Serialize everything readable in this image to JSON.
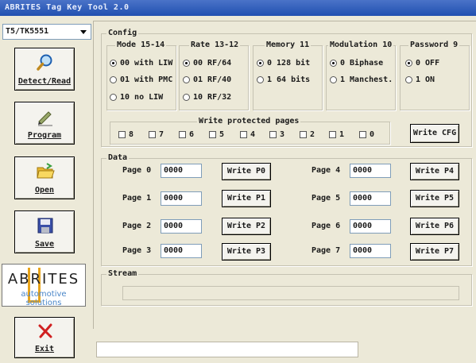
{
  "window": {
    "title": "ABRITES Tag Key Tool 2.0"
  },
  "device_select": {
    "value": "T5/TK5551"
  },
  "sidebar": {
    "detect_label": "Detect/Read",
    "program_label": "Program",
    "open_label": "Open",
    "save_label": "Save",
    "exit_label": "Exit",
    "logo": {
      "brand": "ABRITES",
      "tagline": "automotive solutions"
    }
  },
  "config": {
    "title": "Config",
    "mode": {
      "title": "Mode 15-14",
      "options": [
        "00 with LIW",
        "01 with PMC",
        "10 no LIW"
      ],
      "selected": 0
    },
    "rate": {
      "title": "Rate 13-12",
      "options": [
        "00 RF/64",
        "01 RF/40",
        "10 RF/32"
      ],
      "selected": 0
    },
    "memory": {
      "title": "Memory 11",
      "options": [
        "0 128 bit",
        "1 64 bits"
      ],
      "selected": 0
    },
    "modulation": {
      "title": "Modulation 10",
      "options": [
        "0 Biphase",
        "1 Manchest."
      ],
      "selected": 0
    },
    "password": {
      "title": "Password 9",
      "options": [
        "0 OFF",
        "1 ON"
      ],
      "selected": 0
    },
    "write_protected": {
      "title": "Write protected pages",
      "pages": [
        "8",
        "7",
        "6",
        "5",
        "4",
        "3",
        "2",
        "1",
        "0"
      ]
    },
    "write_cfg_label": "Write CFG"
  },
  "data": {
    "title": "Data",
    "pages": [
      {
        "label": "Page 0",
        "value": "0000",
        "button": "Write P0"
      },
      {
        "label": "Page 1",
        "value": "0000",
        "button": "Write P1"
      },
      {
        "label": "Page 2",
        "value": "0000",
        "button": "Write P2"
      },
      {
        "label": "Page 3",
        "value": "0000",
        "button": "Write P3"
      },
      {
        "label": "Page 4",
        "value": "0000",
        "button": "Write P4"
      },
      {
        "label": "Page 5",
        "value": "0000",
        "button": "Write P5"
      },
      {
        "label": "Page 6",
        "value": "0000",
        "button": "Write P6"
      },
      {
        "label": "Page 7",
        "value": "0000",
        "button": "Write P7"
      }
    ]
  },
  "stream": {
    "title": "Stream",
    "value": ""
  },
  "status": {
    "value": ""
  },
  "colors": {
    "titlebar": "#2150b0",
    "face": "#ece9d8",
    "logo_accent": "#e8a41a",
    "logo_text_blue": "#4a86c8"
  },
  "icons": {
    "detect": "magnifier-icon",
    "program": "pen-icon",
    "open": "folder-icon",
    "save": "floppy-icon",
    "exit": "red-x-icon"
  }
}
